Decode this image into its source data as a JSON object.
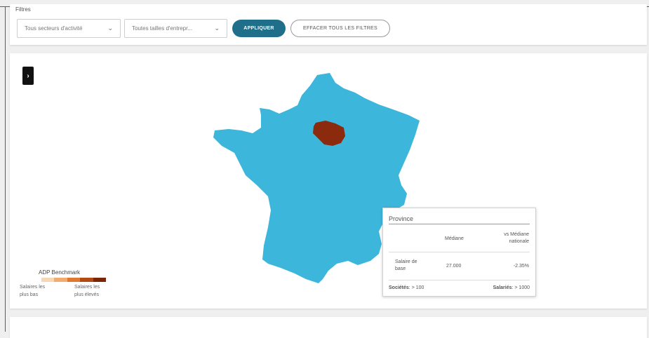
{
  "filters": {
    "label": "Filtres",
    "sector_select": "Tous secteurs d'activité",
    "size_select": "Toutes tailles d'entrepr...",
    "apply_label": "APPLIQUER",
    "clear_label": "EFFACER TOUS LES FILTRES"
  },
  "map": {
    "toggle_label": "›",
    "region_color": "#3db6dc",
    "highlight_color": "#8b2a0c",
    "legend": {
      "title": "ADP Benchmark",
      "colors": [
        "#f8d7b5",
        "#f2ad6e",
        "#e0782f",
        "#b24a13",
        "#7a2508"
      ],
      "low_label": "Salaires les plus bas",
      "high_label": "Salaires les plus élevés"
    }
  },
  "tooltip": {
    "title": "Province",
    "col_median": "Médiane",
    "col_vs": "vs Médiane nationale",
    "row_label": "Salaire de base",
    "row_median": "27.000",
    "row_vs": "-2.35%",
    "footer_left_label": "Sociétés",
    "footer_left_value": ": > 100",
    "footer_right_label": "Salariés",
    "footer_right_value": ": > 1000"
  }
}
